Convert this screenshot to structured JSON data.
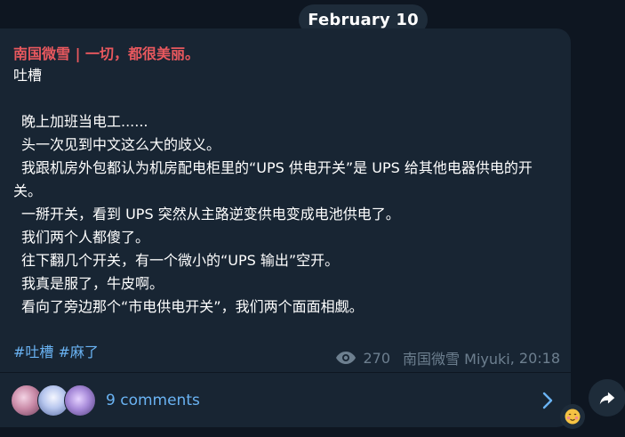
{
  "date_label": "February 10",
  "post": {
    "channel_title": "南国微雪 | 一切，都很美丽。",
    "lines": [
      "吐槽",
      "",
      "晚上加班当电工......",
      "头一次见到中文这么大的歧义。",
      "我跟机房外包都认为机房配电柜里的“UPS 供电开关”是 UPS 给其他电器供电的开关。",
      "一掰开关，看到 UPS 突然从主路逆变供电变成电池供电了。",
      "我们两个人都傻了。",
      "往下翻几个开关，有一个微小的“UPS 输出”空开。",
      "我真是服了，牛皮啊。",
      "看向了旁边那个“市电供电开关”，我们两个面面相觑。"
    ],
    "hashtags": [
      "#吐槽",
      "#麻了"
    ],
    "views": "270",
    "author": "南国微雪 Miyuki",
    "time": "20:18"
  },
  "comments": {
    "label": "9 comments"
  },
  "icons": {
    "views": "eye-icon",
    "open": "chevron-right-icon",
    "share": "share-arrow-icon",
    "reaction": "emoji-icon"
  },
  "colors": {
    "background": "#0e1621",
    "bubble": "#182533",
    "title": "#e8585e",
    "link": "#6ab3f3",
    "meta": "#6d7f8f"
  }
}
